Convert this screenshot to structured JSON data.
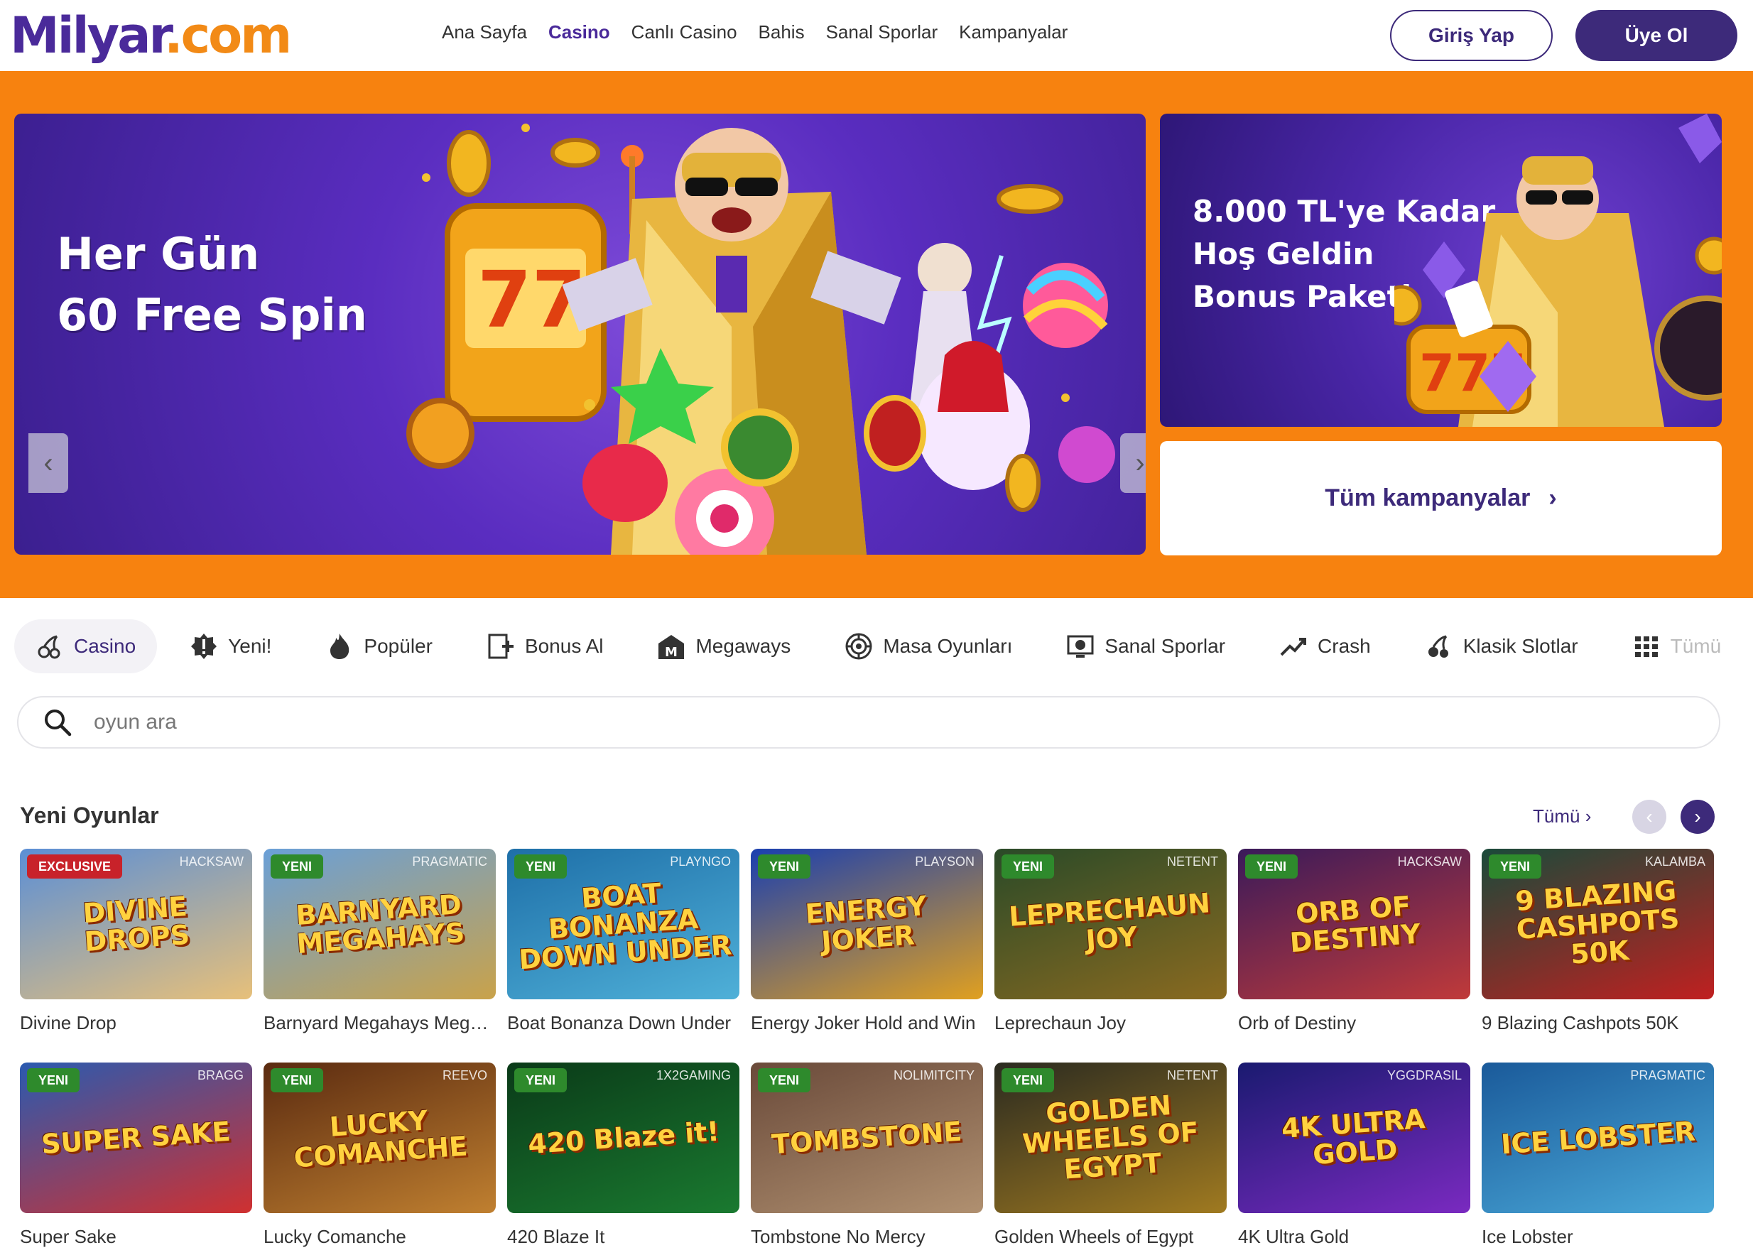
{
  "header": {
    "logo_left": "Milyar",
    "logo_right": ".com",
    "nav": [
      {
        "label": "Ana Sayfa",
        "active": false
      },
      {
        "label": "Casino",
        "active": true
      },
      {
        "label": "Canlı Casino",
        "active": false
      },
      {
        "label": "Bahis",
        "active": false
      },
      {
        "label": "Sanal Sporlar",
        "active": false
      },
      {
        "label": "Kampanyalar",
        "active": false
      }
    ],
    "login_label": "Giriş Yap",
    "register_label": "Üye Ol"
  },
  "hero": {
    "main_line1": "Her Gün",
    "main_line2": "60 Free Spin",
    "side_line1": "8.000 TL'ye Kadar",
    "side_line2": "Hoş Geldin",
    "side_line3": "Bonus Paketi",
    "all_campaigns_label": "Tüm kampanyalar"
  },
  "tabs": [
    {
      "label": "Casino",
      "icon": "cherries-icon",
      "active": true
    },
    {
      "label": "Yeni!",
      "icon": "new-badge-icon"
    },
    {
      "label": "Popüler",
      "icon": "flame-icon"
    },
    {
      "label": "Bonus Al",
      "icon": "bonus-buy-icon"
    },
    {
      "label": "Megaways",
      "icon": "megaways-icon"
    },
    {
      "label": "Masa Oyunları",
      "icon": "roulette-icon"
    },
    {
      "label": "Sanal Sporlar",
      "icon": "virtual-sports-icon"
    },
    {
      "label": "Crash",
      "icon": "trend-up-icon"
    },
    {
      "label": "Klasik Slotlar",
      "icon": "cherries-icon"
    },
    {
      "label": "Tümü",
      "icon": "grid-icon"
    }
  ],
  "search": {
    "placeholder": "oyun ara"
  },
  "section": {
    "title": "Yeni Oyunlar",
    "see_all": "Tümü"
  },
  "colors": {
    "brand_purple": "#3d2a7a",
    "brand_orange": "#f7820f",
    "badge_green": "#2e8a2c",
    "badge_red": "#c8222a"
  },
  "games": [
    {
      "name": "Divine Drop",
      "badge": "EXCLUSIVE",
      "provider": "HACKSAW",
      "art": "DIVINE DROPS",
      "bg1": "#5b8fd6",
      "bg2": "#e7c07a"
    },
    {
      "name": "Barnyard Megahays Megaways",
      "badge": "YENI",
      "provider": "PRAGMATIC",
      "art": "BARNYARD MEGAHAYS",
      "bg1": "#6aa0d8",
      "bg2": "#c9a24a"
    },
    {
      "name": "Boat Bonanza Down Under",
      "badge": "YENI",
      "provider": "PLAYNGO",
      "art": "BOAT BONANZA DOWN UNDER",
      "bg1": "#1e6fa8",
      "bg2": "#4fb0d8"
    },
    {
      "name": "Energy Joker Hold and Win",
      "badge": "YENI",
      "provider": "PLAYSON",
      "art": "ENERGY JOKER",
      "bg1": "#1a3fb0",
      "bg2": "#e0a020"
    },
    {
      "name": "Leprechaun Joy",
      "badge": "YENI",
      "provider": "NETENT",
      "art": "LEPRECHAUN JOY",
      "bg1": "#2a4a28",
      "bg2": "#8a6a20"
    },
    {
      "name": "Orb of Destiny",
      "badge": "YENI",
      "provider": "HACKSAW",
      "art": "ORB OF DESTINY",
      "bg1": "#3a1a5a",
      "bg2": "#c03a3a"
    },
    {
      "name": "9 Blazing Cashpots 50K",
      "badge": "YENI",
      "provider": "KALAMBA",
      "art": "9 BLAZING CASHPOTS 50K",
      "bg1": "#1a4a3a",
      "bg2": "#c02020"
    },
    {
      "name": "Super Sake",
      "badge": "YENI",
      "provider": "BRAGG",
      "art": "SUPER SAKE",
      "bg1": "#2a5ab0",
      "bg2": "#d03030"
    },
    {
      "name": "Lucky Comanche",
      "badge": "YENI",
      "provider": "REEVO",
      "art": "LUCKY COMANCHE",
      "bg1": "#5a2a10",
      "bg2": "#c08030"
    },
    {
      "name": "420 Blaze It",
      "badge": "YENI",
      "provider": "1X2GAMING",
      "art": "420 Blaze it!",
      "bg1": "#0a3a18",
      "bg2": "#1a7a30"
    },
    {
      "name": "Tombstone No Mercy",
      "badge": "YENI",
      "provider": "NOLIMITCITY",
      "art": "TOMBSTONE",
      "bg1": "#6a4a3a",
      "bg2": "#b09070"
    },
    {
      "name": "Golden Wheels of Egypt",
      "badge": "YENI",
      "provider": "NETENT",
      "art": "GOLDEN WHEELS OF EGYPT",
      "bg1": "#2a2a20",
      "bg2": "#a07a20"
    },
    {
      "name": "4K Ultra Gold",
      "badge": "",
      "provider": "YGGDRASIL",
      "art": "4K ULTRA GOLD",
      "bg1": "#1a1a70",
      "bg2": "#7a2ac0"
    },
    {
      "name": "Ice Lobster",
      "badge": "",
      "provider": "PRAGMATIC",
      "art": "ICE LOBSTER",
      "bg1": "#1a5a9a",
      "bg2": "#4aa8d8"
    }
  ]
}
